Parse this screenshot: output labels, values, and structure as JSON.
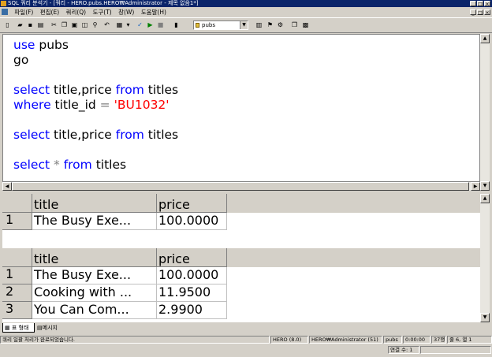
{
  "window": {
    "title": "SQL 쿼리 분석기 - [쿼리 - HERO.pubs.HERO₩Administrator - 제목 없음1*]",
    "buttons": [
      "_",
      "□",
      "×"
    ]
  },
  "menu": {
    "items": [
      "파일(F)",
      "편집(E)",
      "쿼리(Q)",
      "도구(T)",
      "창(W)",
      "도움말(H)"
    ],
    "mdi_buttons": [
      "_",
      "□",
      "×"
    ]
  },
  "toolbar": {
    "database": "pubs"
  },
  "editor": {
    "lines": [
      [
        {
          "t": "use",
          "c": "kw"
        },
        {
          "t": " pubs",
          "c": ""
        }
      ],
      [
        {
          "t": "go",
          "c": ""
        }
      ],
      [],
      [
        {
          "t": "select",
          "c": "kw"
        },
        {
          "t": " title,price ",
          "c": ""
        },
        {
          "t": "from",
          "c": "kw"
        },
        {
          "t": " titles",
          "c": ""
        }
      ],
      [
        {
          "t": "where",
          "c": "kw"
        },
        {
          "t": " title_id ",
          "c": ""
        },
        {
          "t": "=",
          "c": "op"
        },
        {
          "t": " ",
          "c": ""
        },
        {
          "t": "'BU1032'",
          "c": "str"
        }
      ],
      [],
      [
        {
          "t": "select",
          "c": "kw"
        },
        {
          "t": " title,price ",
          "c": ""
        },
        {
          "t": "from",
          "c": "kw"
        },
        {
          "t": " titles",
          "c": ""
        }
      ],
      [],
      [
        {
          "t": "select",
          "c": "kw"
        },
        {
          "t": " ",
          "c": ""
        },
        {
          "t": "*",
          "c": "op"
        },
        {
          "t": " ",
          "c": ""
        },
        {
          "t": "from",
          "c": "kw"
        },
        {
          "t": " titles",
          "c": ""
        }
      ]
    ]
  },
  "results": {
    "grid1": {
      "columns": [
        "title",
        "price"
      ],
      "rows": [
        [
          "1",
          "The Busy Exe...",
          "100.0000"
        ]
      ]
    },
    "grid2": {
      "columns": [
        "title",
        "price"
      ],
      "rows": [
        [
          "1",
          "The Busy Exe...",
          "100.0000"
        ],
        [
          "2",
          "Cooking with ...",
          "11.9500"
        ],
        [
          "3",
          "You Can Com...",
          "2.9900"
        ]
      ]
    }
  },
  "tabs": {
    "grid_label": "표 형태",
    "messages_label": "메시지"
  },
  "status": {
    "message": "쿼리 일괄 처리가 완료되었습니다.",
    "server": "HERO (8.0)",
    "user": "HERO₩Administrator (51)",
    "db": "pubs",
    "time": "0:00:00",
    "rows": "37행",
    "position": "줄 6, 열 1",
    "connections": "연결 수: 1"
  }
}
